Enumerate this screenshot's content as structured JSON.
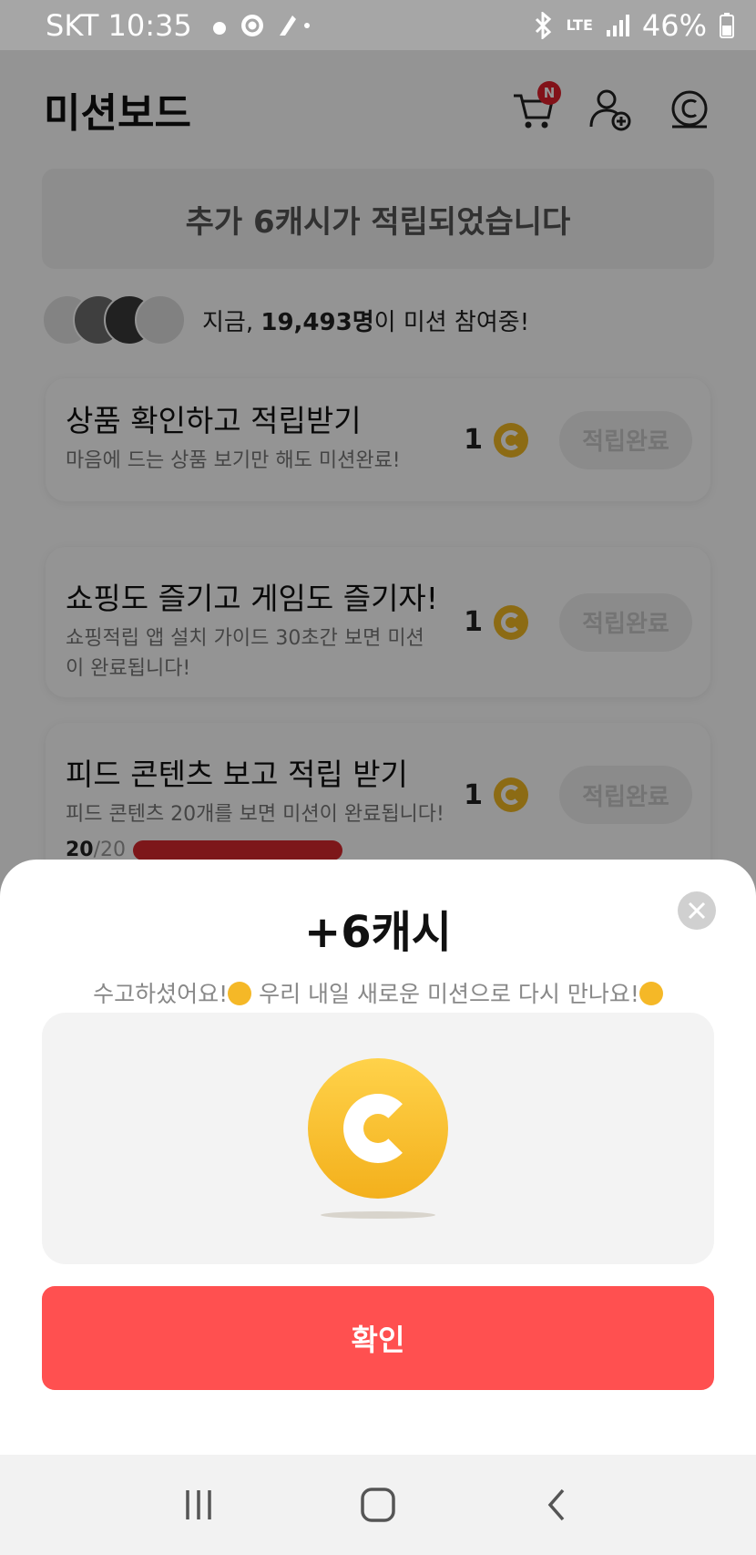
{
  "status_bar": {
    "carrier_time": "SKT 10:35",
    "network": "LTE",
    "battery": "46%"
  },
  "header": {
    "title": "미션보드",
    "cart_badge": "N",
    "icons": [
      "cart-icon",
      "add-friend-icon",
      "cash-icon"
    ]
  },
  "banner": {
    "text": "추가 6캐시가 적립되었습니다"
  },
  "participants": {
    "prefix": "지금, ",
    "count": "19,493명",
    "suffix": "이 미션 참여중!"
  },
  "missions": [
    {
      "title": "상품 확인하고 적립받기",
      "desc": "마음에 드는 상품 보기만 해도 미션완료!",
      "reward": "1",
      "button": "적립완료"
    },
    {
      "title": "쇼핑도 즐기고 게임도 즐기자!",
      "desc": "쇼핑적립 앱 설치 가이드 30초간 보면 미션이 완료됩니다!",
      "reward": "1",
      "button": "적립완료"
    },
    {
      "title": "피드 콘텐츠 보고 적립 받기",
      "desc": "피드 콘텐츠 20개를 보면 미션이 완료됩니다!",
      "reward": "1",
      "button": "적립완료",
      "progress_done": "20",
      "progress_total": "/20",
      "progress_fraction": 1.0
    }
  ],
  "modal": {
    "title": "+6캐시",
    "message_part1": "수고하셨어요!",
    "message_part2": " 우리 내일 새로운 미션으로 다시 만나요!",
    "confirm_label": "확인"
  },
  "colors": {
    "accent": "#ff5050",
    "coin": "#f3b01c",
    "progress": "#d8282e"
  }
}
